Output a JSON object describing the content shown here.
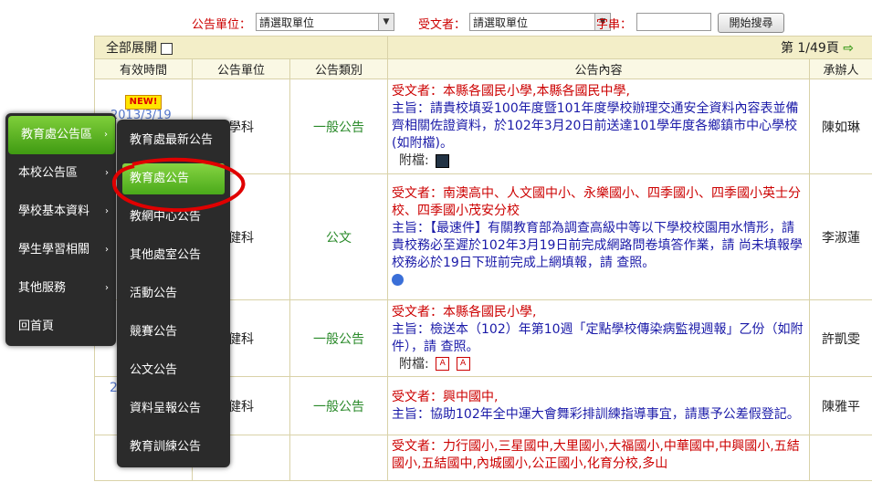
{
  "search": {
    "unit_label": "公告單位：",
    "unit_value": "請選取單位",
    "recipient_label": "受文者：",
    "recipient_value": "請選取單位",
    "keyword_label": "字串：",
    "keyword_value": "",
    "search_button": "開始搜尋"
  },
  "table": {
    "expand_all": "全部展開",
    "page_info": "第 1/49頁",
    "headers": [
      "有效時間",
      "公告單位",
      "公告類別",
      "公告內容",
      "承辦人"
    ],
    "rows": [
      {
        "date": "2013/3/19",
        "unit": "學科",
        "category": "一般公告",
        "recipients": "受文者：本縣各國民小學,本縣各國民中學,",
        "subject": "主旨：請貴校填妥100年度暨101年度學校辦理交通安全資料內容表並備齊相關佐證資料，於102年3月20日前送達101學年度各鄉鎮市中心學校(如附檔)。",
        "attachment_label": "附檔:",
        "person": "陳如琳"
      },
      {
        "unit": "健科",
        "category": "公文",
        "recipients": "受文者：南澳高中、人文國中小、永樂國小、四季國小、四季國小英士分校、四季國小茂安分校",
        "subject": "主旨：【最速件】有關教育部為調查高級中等以下學校校園用水情形，請 貴校務必至遲於102年3月19日前完成網路問卷填答作業，請 尚未填報學校務必於19日下班前完成上網填報，請 查照。",
        "person": "李淑蓮"
      },
      {
        "unit": "健科",
        "category": "一般公告",
        "recipients": "受文者：本縣各國民小學,",
        "subject": "主旨：檢送本（102）年第10週「定點學校傳染病監視週報」乙份（如附件），請 查照。",
        "attachment_label": "附檔:",
        "person": "許凱雯"
      },
      {
        "date_peek": "2",
        "unit": "健科",
        "category": "一般公告",
        "recipients": "受文者：興中國中,",
        "subject": "主旨：協助102年全中運大會舞彩排訓練指導事宜，請惠予公差假登記。",
        "person": "陳雅平"
      },
      {
        "recipients": "受文者：力行國小,三星國中,大里國小,大福國小,中華國中,中興國小,五結國小,五結國中,內城國小,公正國小,化育分校,多山"
      }
    ]
  },
  "menu_main": {
    "items": [
      "教育處公告區",
      "本校公告區",
      "學校基本資料",
      "學生學習相關",
      "其他服務",
      "回首頁"
    ]
  },
  "menu_sub": {
    "items": [
      "教育處最新公告",
      "教育處公告",
      "教網中心公告",
      "其他處室公告",
      "活動公告",
      "競賽公告",
      "公文公告",
      "資料呈報公告",
      "教育訓練公告"
    ]
  },
  "badge_new": "NEW!",
  "colors": {
    "accent_green": "#4aa91a",
    "header_bg": "#f3eec8",
    "highlight_circle": "#e00000"
  }
}
